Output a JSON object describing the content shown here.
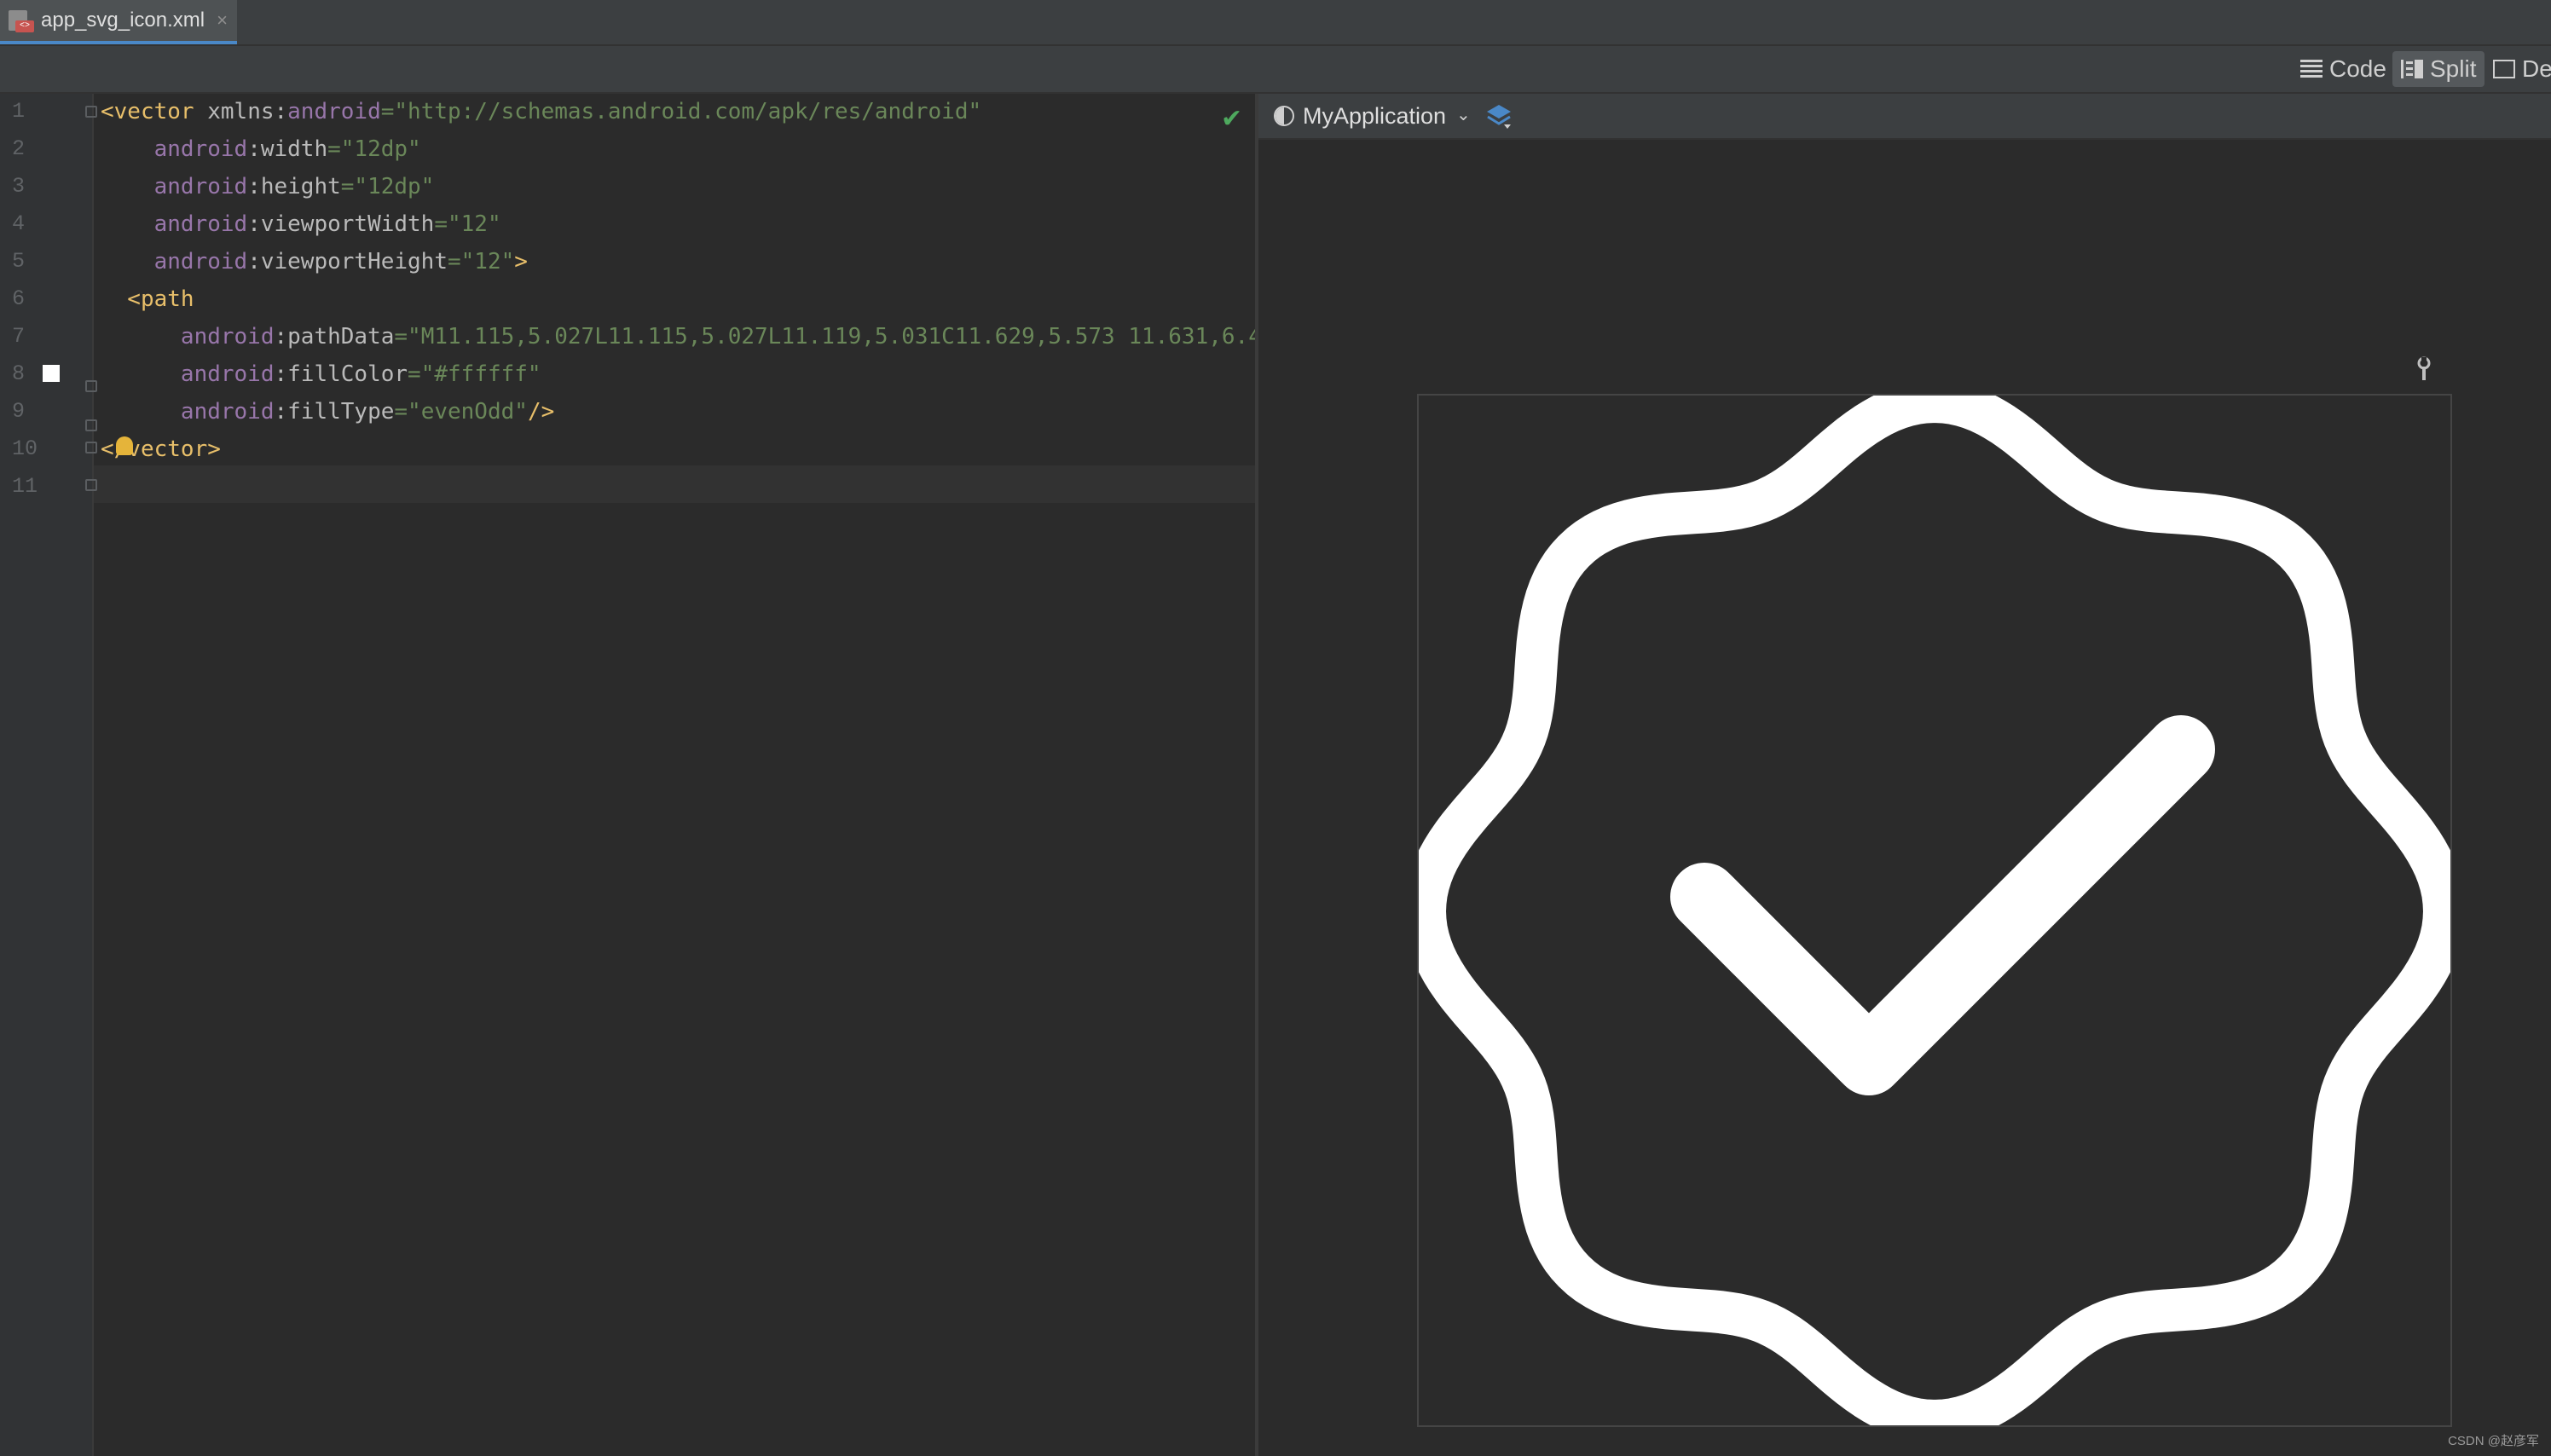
{
  "tab": {
    "filename": "app_svg_icon.xml",
    "close": "×",
    "badge": "<>"
  },
  "modes": {
    "code": "Code",
    "split": "Split",
    "design": "De"
  },
  "editor": {
    "line_numbers": [
      "1",
      "2",
      "3",
      "4",
      "5",
      "6",
      "7",
      "8",
      "9",
      "10",
      "11"
    ],
    "lines": [
      [
        {
          "t": "<vector ",
          "c": "tag"
        },
        {
          "t": "xmlns:",
          "c": "attr"
        },
        {
          "t": "android",
          "c": "ns"
        },
        {
          "t": "=\"http://schemas.android.com/apk/res/android\"",
          "c": "str"
        }
      ],
      [
        {
          "t": "    android",
          "c": "ns"
        },
        {
          "t": ":width",
          "c": "attr"
        },
        {
          "t": "=\"12dp\"",
          "c": "str"
        }
      ],
      [
        {
          "t": "    android",
          "c": "ns"
        },
        {
          "t": ":height",
          "c": "attr"
        },
        {
          "t": "=\"12dp\"",
          "c": "str"
        }
      ],
      [
        {
          "t": "    android",
          "c": "ns"
        },
        {
          "t": ":viewportWidth",
          "c": "attr"
        },
        {
          "t": "=\"12\"",
          "c": "str"
        }
      ],
      [
        {
          "t": "    android",
          "c": "ns"
        },
        {
          "t": ":viewportHeight",
          "c": "attr"
        },
        {
          "t": "=\"12\"",
          "c": "str"
        },
        {
          "t": ">",
          "c": "tag"
        }
      ],
      [
        {
          "t": "  <path",
          "c": "tag"
        }
      ],
      [
        {
          "t": "      android",
          "c": "ns"
        },
        {
          "t": ":pathData",
          "c": "attr"
        },
        {
          "t": "=\"M11.115,5.027L11.115,5.027L11.119,5.031C11.629,5.573 11.631,6.4",
          "c": "str"
        }
      ],
      [
        {
          "t": "      android",
          "c": "ns"
        },
        {
          "t": ":fillColor",
          "c": "attr"
        },
        {
          "t": "=\"#ffffff\"",
          "c": "str"
        }
      ],
      [
        {
          "t": "      android",
          "c": "ns"
        },
        {
          "t": ":fillType",
          "c": "attr"
        },
        {
          "t": "=\"evenOdd\"",
          "c": "str"
        },
        {
          "t": "/>",
          "c": "tag"
        }
      ],
      [
        {
          "t": "</vector>",
          "c": "tag"
        }
      ],
      []
    ],
    "status_icon": "check-icon",
    "fill_color_swatch": "#ffffff"
  },
  "preview": {
    "app_name": "MyApplication",
    "caret": "⌄",
    "wrench": "🔧"
  },
  "watermark": "CSDN @赵彦军",
  "colors": {
    "accent": "#4a88c7",
    "check": "#4ea95e",
    "icon_fill": "#ffffff"
  }
}
